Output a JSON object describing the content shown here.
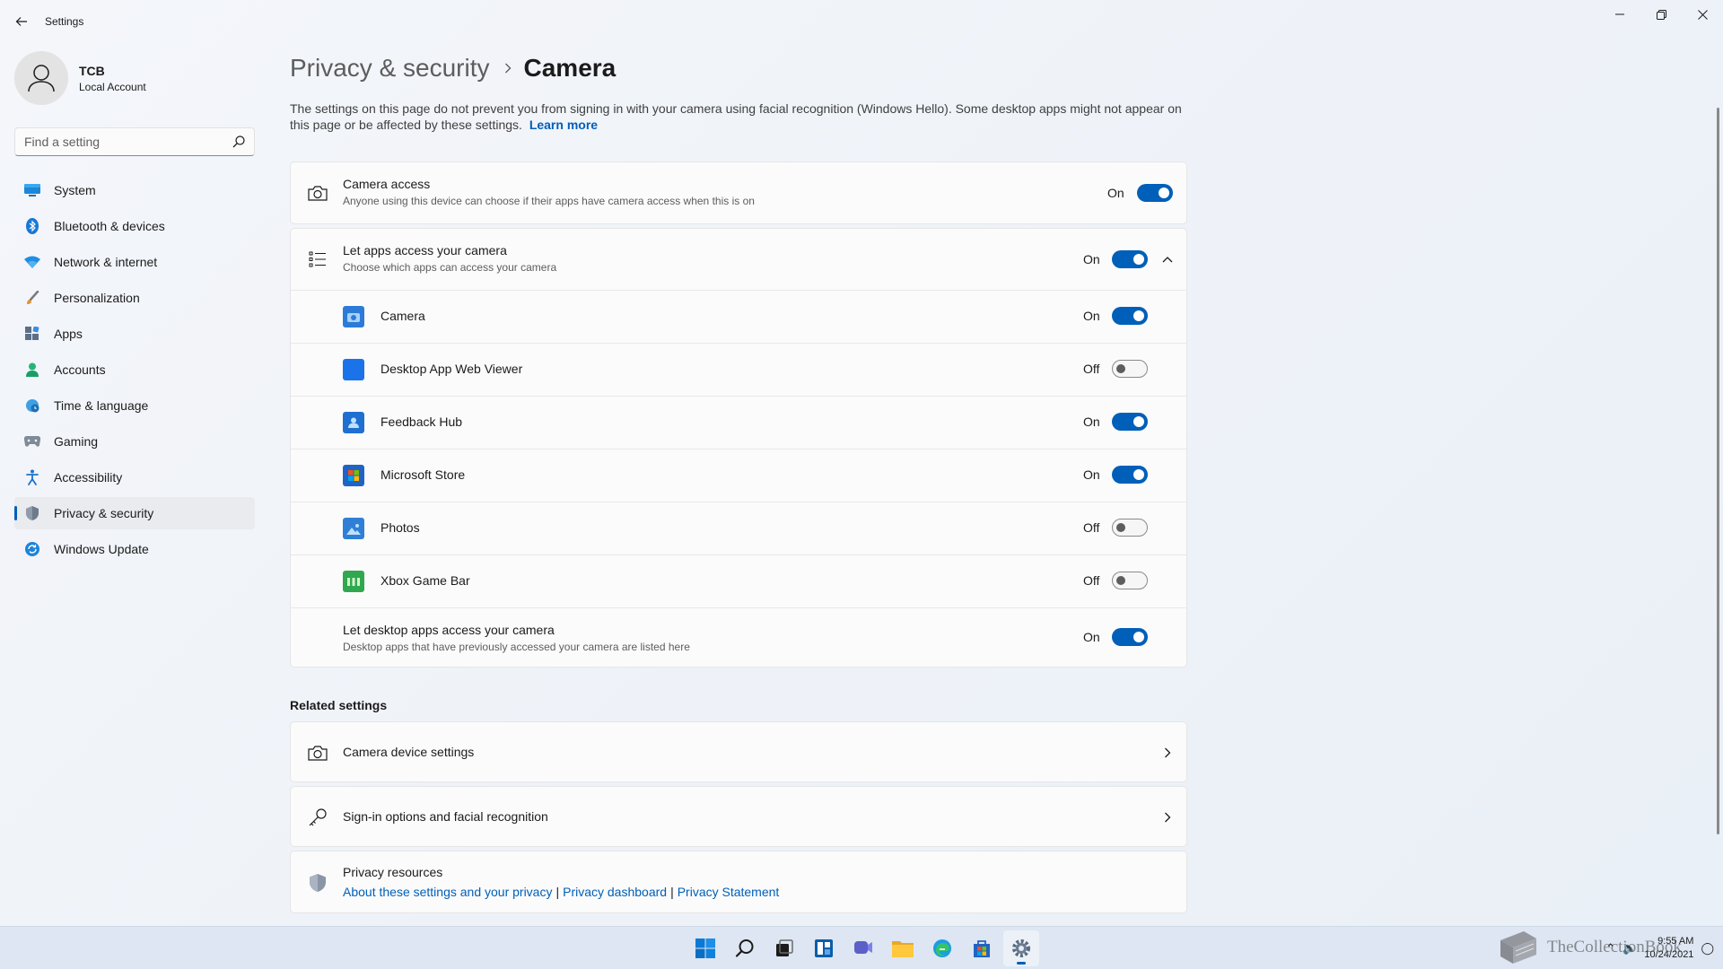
{
  "window": {
    "app_title": "Settings",
    "minimize_icon": "minimize-icon",
    "maximize_icon": "restore-icon",
    "close_icon": "close-icon"
  },
  "profile": {
    "name": "TCB",
    "account_type": "Local Account"
  },
  "search": {
    "placeholder": "Find a setting",
    "value": ""
  },
  "sidebar": {
    "items": [
      {
        "label": "System",
        "icon": "monitor-icon",
        "active": false
      },
      {
        "label": "Bluetooth & devices",
        "icon": "bluetooth-icon",
        "active": false
      },
      {
        "label": "Network & internet",
        "icon": "wifi-icon",
        "active": false
      },
      {
        "label": "Personalization",
        "icon": "brush-icon",
        "active": false
      },
      {
        "label": "Apps",
        "icon": "apps-icon",
        "active": false
      },
      {
        "label": "Accounts",
        "icon": "person-icon",
        "active": false
      },
      {
        "label": "Time & language",
        "icon": "globe-clock-icon",
        "active": false
      },
      {
        "label": "Gaming",
        "icon": "gamepad-icon",
        "active": false
      },
      {
        "label": "Accessibility",
        "icon": "accessibility-icon",
        "active": false
      },
      {
        "label": "Privacy & security",
        "icon": "shield-icon",
        "active": true
      },
      {
        "label": "Windows Update",
        "icon": "update-icon",
        "active": false
      }
    ]
  },
  "main": {
    "breadcrumb_parent": "Privacy & security",
    "breadcrumb_current": "Camera",
    "description": "The settings on this page do not prevent you from signing in with your camera using facial recognition (Windows Hello). Some desktop apps might not appear on this page or be affected by these settings.",
    "learn_more": "Learn more",
    "camera_access": {
      "title": "Camera access",
      "subtitle": "Anyone using this device can choose if their apps have camera access when this is on",
      "state": "On"
    },
    "let_apps": {
      "title": "Let apps access your camera",
      "subtitle": "Choose which apps can access your camera",
      "state": "On",
      "expanded": true
    },
    "apps": [
      {
        "name": "Camera",
        "state": "On",
        "icon": "camera-app-icon",
        "color": "#2d7bd8"
      },
      {
        "name": "Desktop App Web Viewer",
        "state": "Off",
        "icon": "web-viewer-app-icon",
        "color": "#1a73e8"
      },
      {
        "name": "Feedback Hub",
        "state": "On",
        "icon": "feedback-hub-app-icon",
        "color": "#1f6fd1"
      },
      {
        "name": "Microsoft Store",
        "state": "On",
        "icon": "store-app-icon",
        "color": "#1f64c4"
      },
      {
        "name": "Photos",
        "state": "Off",
        "icon": "photos-app-icon",
        "color": "#2f7fd6"
      },
      {
        "name": "Xbox Game Bar",
        "state": "Off",
        "icon": "xbox-game-bar-app-icon",
        "color": "#2fa84f"
      }
    ],
    "desktop_apps": {
      "title": "Let desktop apps access your camera",
      "subtitle": "Desktop apps that have previously accessed your camera are listed here",
      "state": "On"
    },
    "related_heading": "Related settings",
    "related": [
      {
        "label": "Camera device settings",
        "icon": "camera-icon"
      },
      {
        "label": "Sign-in options and facial recognition",
        "icon": "key-icon"
      }
    ],
    "privacy_resources": {
      "title": "Privacy resources",
      "links": [
        "About these settings and your privacy",
        "Privacy dashboard",
        "Privacy Statement"
      ],
      "separator": "|"
    }
  },
  "taskbar": {
    "apps": [
      "start-icon",
      "search-icon",
      "task-view-icon",
      "widgets-icon",
      "chat-icon",
      "file-explorer-icon",
      "edge-icon",
      "store-icon",
      "settings-icon"
    ],
    "active_app": "settings-icon",
    "time": "9:55 AM",
    "date": "10/24/2021"
  },
  "watermark": {
    "text": "TheCollectionBook"
  },
  "colors": {
    "accent": "#005fb8",
    "toggle_off_knob": "#5d5d5d"
  }
}
